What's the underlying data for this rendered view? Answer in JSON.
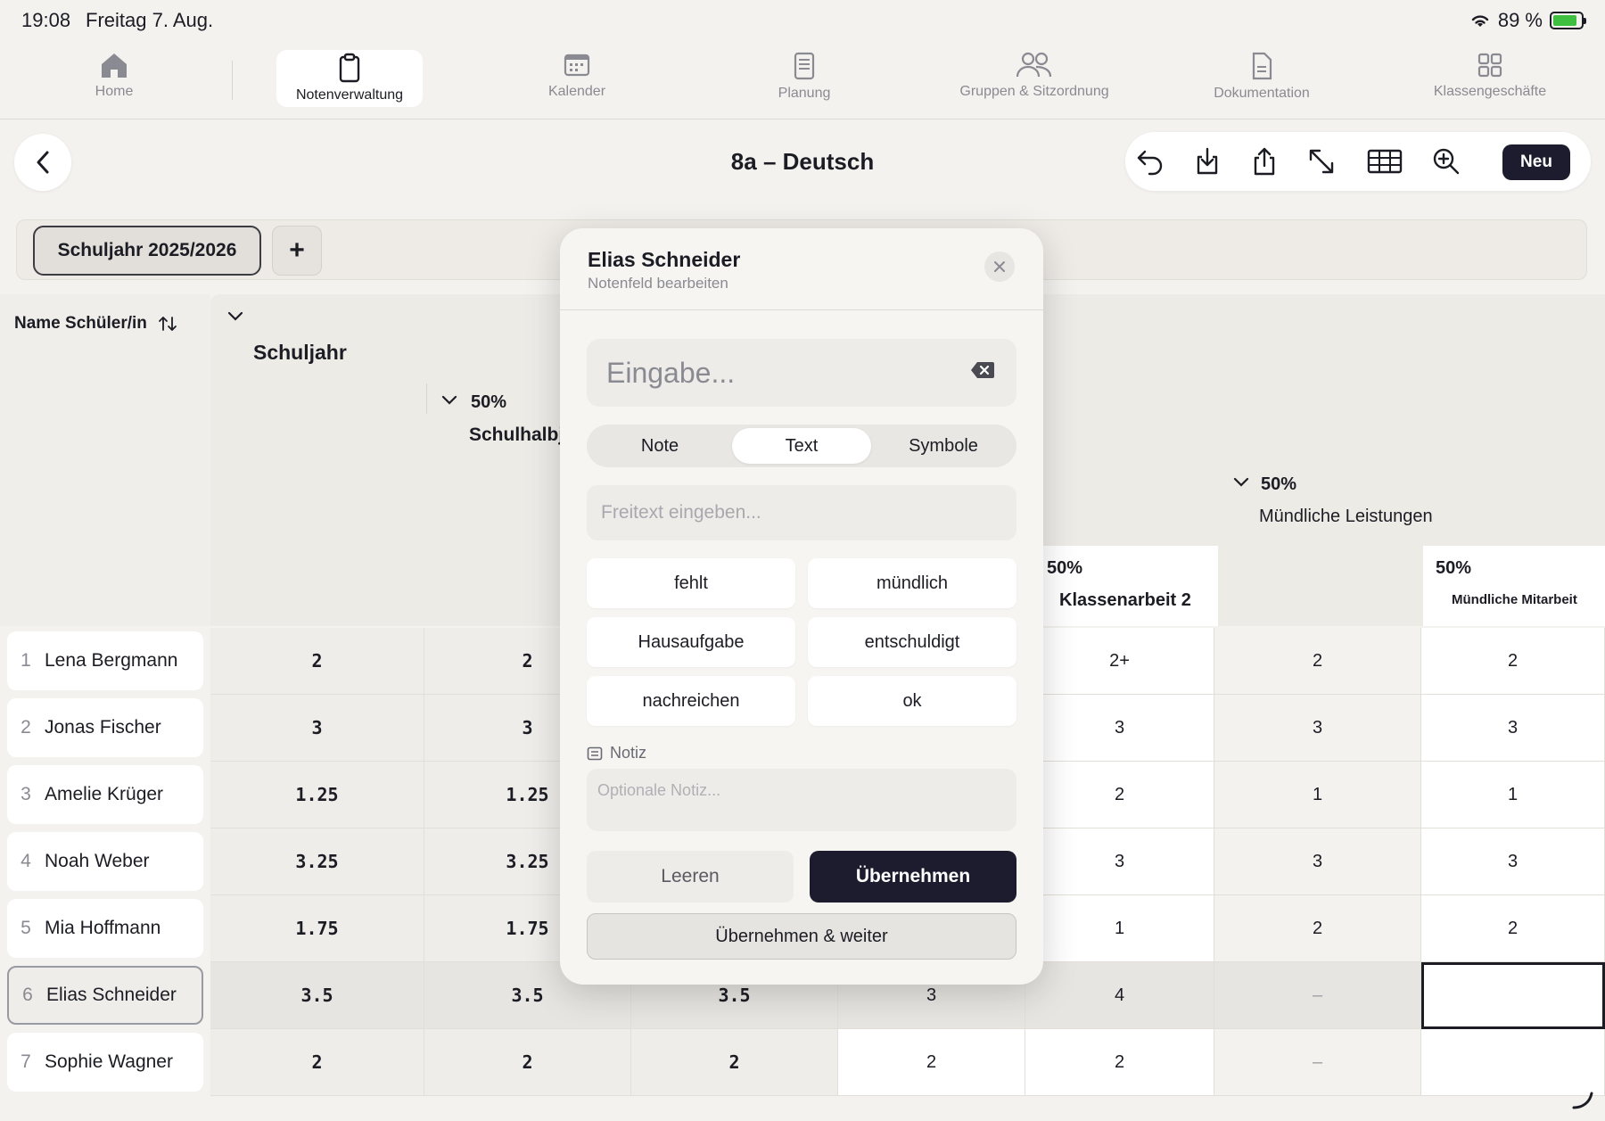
{
  "status": {
    "time": "19:08",
    "date": "Freitag 7. Aug.",
    "battery": "89 %"
  },
  "nav": {
    "items": [
      {
        "label": "Home",
        "icon": "home-icon"
      },
      {
        "label": "Notenverwaltung",
        "icon": "clipboard-icon"
      },
      {
        "label": "Kalender",
        "icon": "calendar-icon"
      },
      {
        "label": "Planung",
        "icon": "notebook-icon"
      },
      {
        "label": "Gruppen & Sitzordnung",
        "icon": "users-icon"
      },
      {
        "label": "Dokumentation",
        "icon": "document-icon"
      },
      {
        "label": "Klassengeschäfte",
        "icon": "grid-icon"
      }
    ],
    "active": "Notenverwaltung"
  },
  "header": {
    "title": "8a – Deutsch",
    "new_label": "Neu"
  },
  "yearbar": {
    "year": "Schuljahr 2025/2026",
    "add": "+"
  },
  "grid": {
    "name_header": "Name Schüler/in",
    "headers": {
      "schuljahr": "Schuljahr",
      "halbjahr_pct": "50%",
      "halbjahr": "Schulhalbj",
      "muendlich_pct": "50%",
      "muendlich": "Mündliche Leistungen",
      "ka2_pct": "50%",
      "ka2": "Klassenarbeit 2",
      "mitarbeit_pct": "50%",
      "mitarbeit": "Mündliche Mitarbeit"
    },
    "students": [
      {
        "num": "1",
        "name": "Lena Bergmann",
        "c1": "2",
        "c2": "2",
        "c3": "",
        "c4": "",
        "c5": "2+",
        "c6": "2",
        "c7": "2"
      },
      {
        "num": "2",
        "name": "Jonas Fischer",
        "c1": "3",
        "c2": "3",
        "c3": "",
        "c4": "",
        "c5": "3",
        "c6": "3",
        "c7": "3"
      },
      {
        "num": "3",
        "name": "Amelie Krüger",
        "c1": "1.25",
        "c2": "1.25",
        "c3": "",
        "c4": "",
        "c5": "2",
        "c6": "1",
        "c7": "1"
      },
      {
        "num": "4",
        "name": "Noah Weber",
        "c1": "3.25",
        "c2": "3.25",
        "c3": "",
        "c4": "",
        "c5": "3",
        "c6": "3",
        "c7": "3"
      },
      {
        "num": "5",
        "name": "Mia Hoffmann",
        "c1": "1.75",
        "c2": "1.75",
        "c3": "",
        "c4": "",
        "c5": "1",
        "c6": "2",
        "c7": "2"
      },
      {
        "num": "6",
        "name": "Elias Schneider",
        "c1": "3.5",
        "c2": "3.5",
        "c3": "3.5",
        "c4": "3",
        "c5": "4",
        "c6": "–",
        "c7": ""
      },
      {
        "num": "7",
        "name": "Sophie Wagner",
        "c1": "2",
        "c2": "2",
        "c3": "2",
        "c4": "2",
        "c5": "2",
        "c6": "–",
        "c7": ""
      }
    ]
  },
  "modal": {
    "name": "Elias Schneider",
    "subtitle": "Notenfeld bearbeiten",
    "input_placeholder": "Eingabe...",
    "tabs": [
      "Note",
      "Text",
      "Symbole"
    ],
    "active_tab": "Text",
    "freetext_placeholder": "Freitext eingeben...",
    "chips": [
      "fehlt",
      "mündlich",
      "Hausaufgabe",
      "entschuldigt",
      "nachreichen",
      "ok"
    ],
    "note_label": "Notiz",
    "note_placeholder": "Optionale Notiz...",
    "clear_label": "Leeren",
    "apply_label": "Übernehmen",
    "apply_next_label": "Übernehmen & weiter"
  }
}
